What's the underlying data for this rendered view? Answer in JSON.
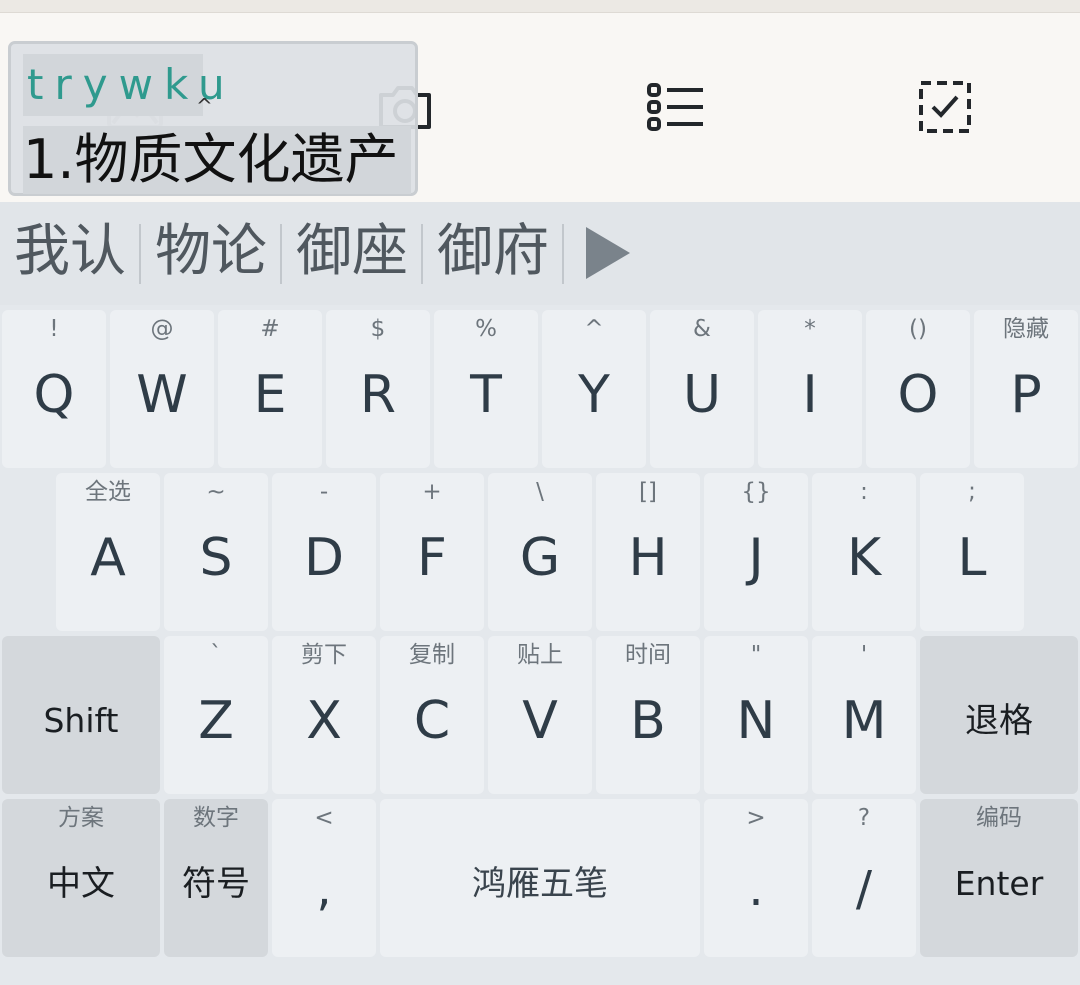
{
  "composition": {
    "code": "trywku",
    "caret": "^",
    "candidate": "1.物质文化遗产"
  },
  "toolbar": {
    "icons": [
      "image-icon",
      "camera-icon",
      "list-icon",
      "select-icon"
    ]
  },
  "candidates": {
    "items": [
      "我认",
      "物论",
      "御座",
      "御府"
    ],
    "more_icon": "triangle-right-icon"
  },
  "keyboard": {
    "row1": [
      {
        "hint": "!",
        "label": "Q"
      },
      {
        "hint": "@",
        "label": "W"
      },
      {
        "hint": "#",
        "label": "E"
      },
      {
        "hint": "$",
        "label": "R"
      },
      {
        "hint": "%",
        "label": "T"
      },
      {
        "hint": "^",
        "label": "Y"
      },
      {
        "hint": "&",
        "label": "U"
      },
      {
        "hint": "*",
        "label": "I"
      },
      {
        "hint": "()",
        "label": "O"
      },
      {
        "hint": "隐藏",
        "label": "P"
      }
    ],
    "row2": [
      {
        "hint": "全选",
        "label": "A"
      },
      {
        "hint": "~",
        "label": "S"
      },
      {
        "hint": "-",
        "label": "D"
      },
      {
        "hint": "+",
        "label": "F"
      },
      {
        "hint": "\\",
        "label": "G"
      },
      {
        "hint": "[]",
        "label": "H"
      },
      {
        "hint": "{}",
        "label": "J"
      },
      {
        "hint": ":",
        "label": "K"
      },
      {
        "hint": ";",
        "label": "L"
      }
    ],
    "row3": {
      "shift": "Shift",
      "keys": [
        {
          "hint": "`",
          "label": "Z"
        },
        {
          "hint": "剪下",
          "label": "X"
        },
        {
          "hint": "复制",
          "label": "C"
        },
        {
          "hint": "贴上",
          "label": "V"
        },
        {
          "hint": "时间",
          "label": "B"
        },
        {
          "hint": "\"",
          "label": "N"
        },
        {
          "hint": "'",
          "label": "M"
        }
      ],
      "backspace": "退格"
    },
    "row4": {
      "lang": {
        "hint": "方案",
        "label": "中文"
      },
      "symbols": {
        "hint": "数字",
        "label": "符号"
      },
      "comma": {
        "hint": "<",
        "label": ","
      },
      "space": "鸿雁五笔",
      "period": {
        "hint": ">",
        "label": "."
      },
      "slash": {
        "hint": "?",
        "label": "/"
      },
      "enter": {
        "hint": "编码",
        "label": "Enter"
      }
    }
  }
}
